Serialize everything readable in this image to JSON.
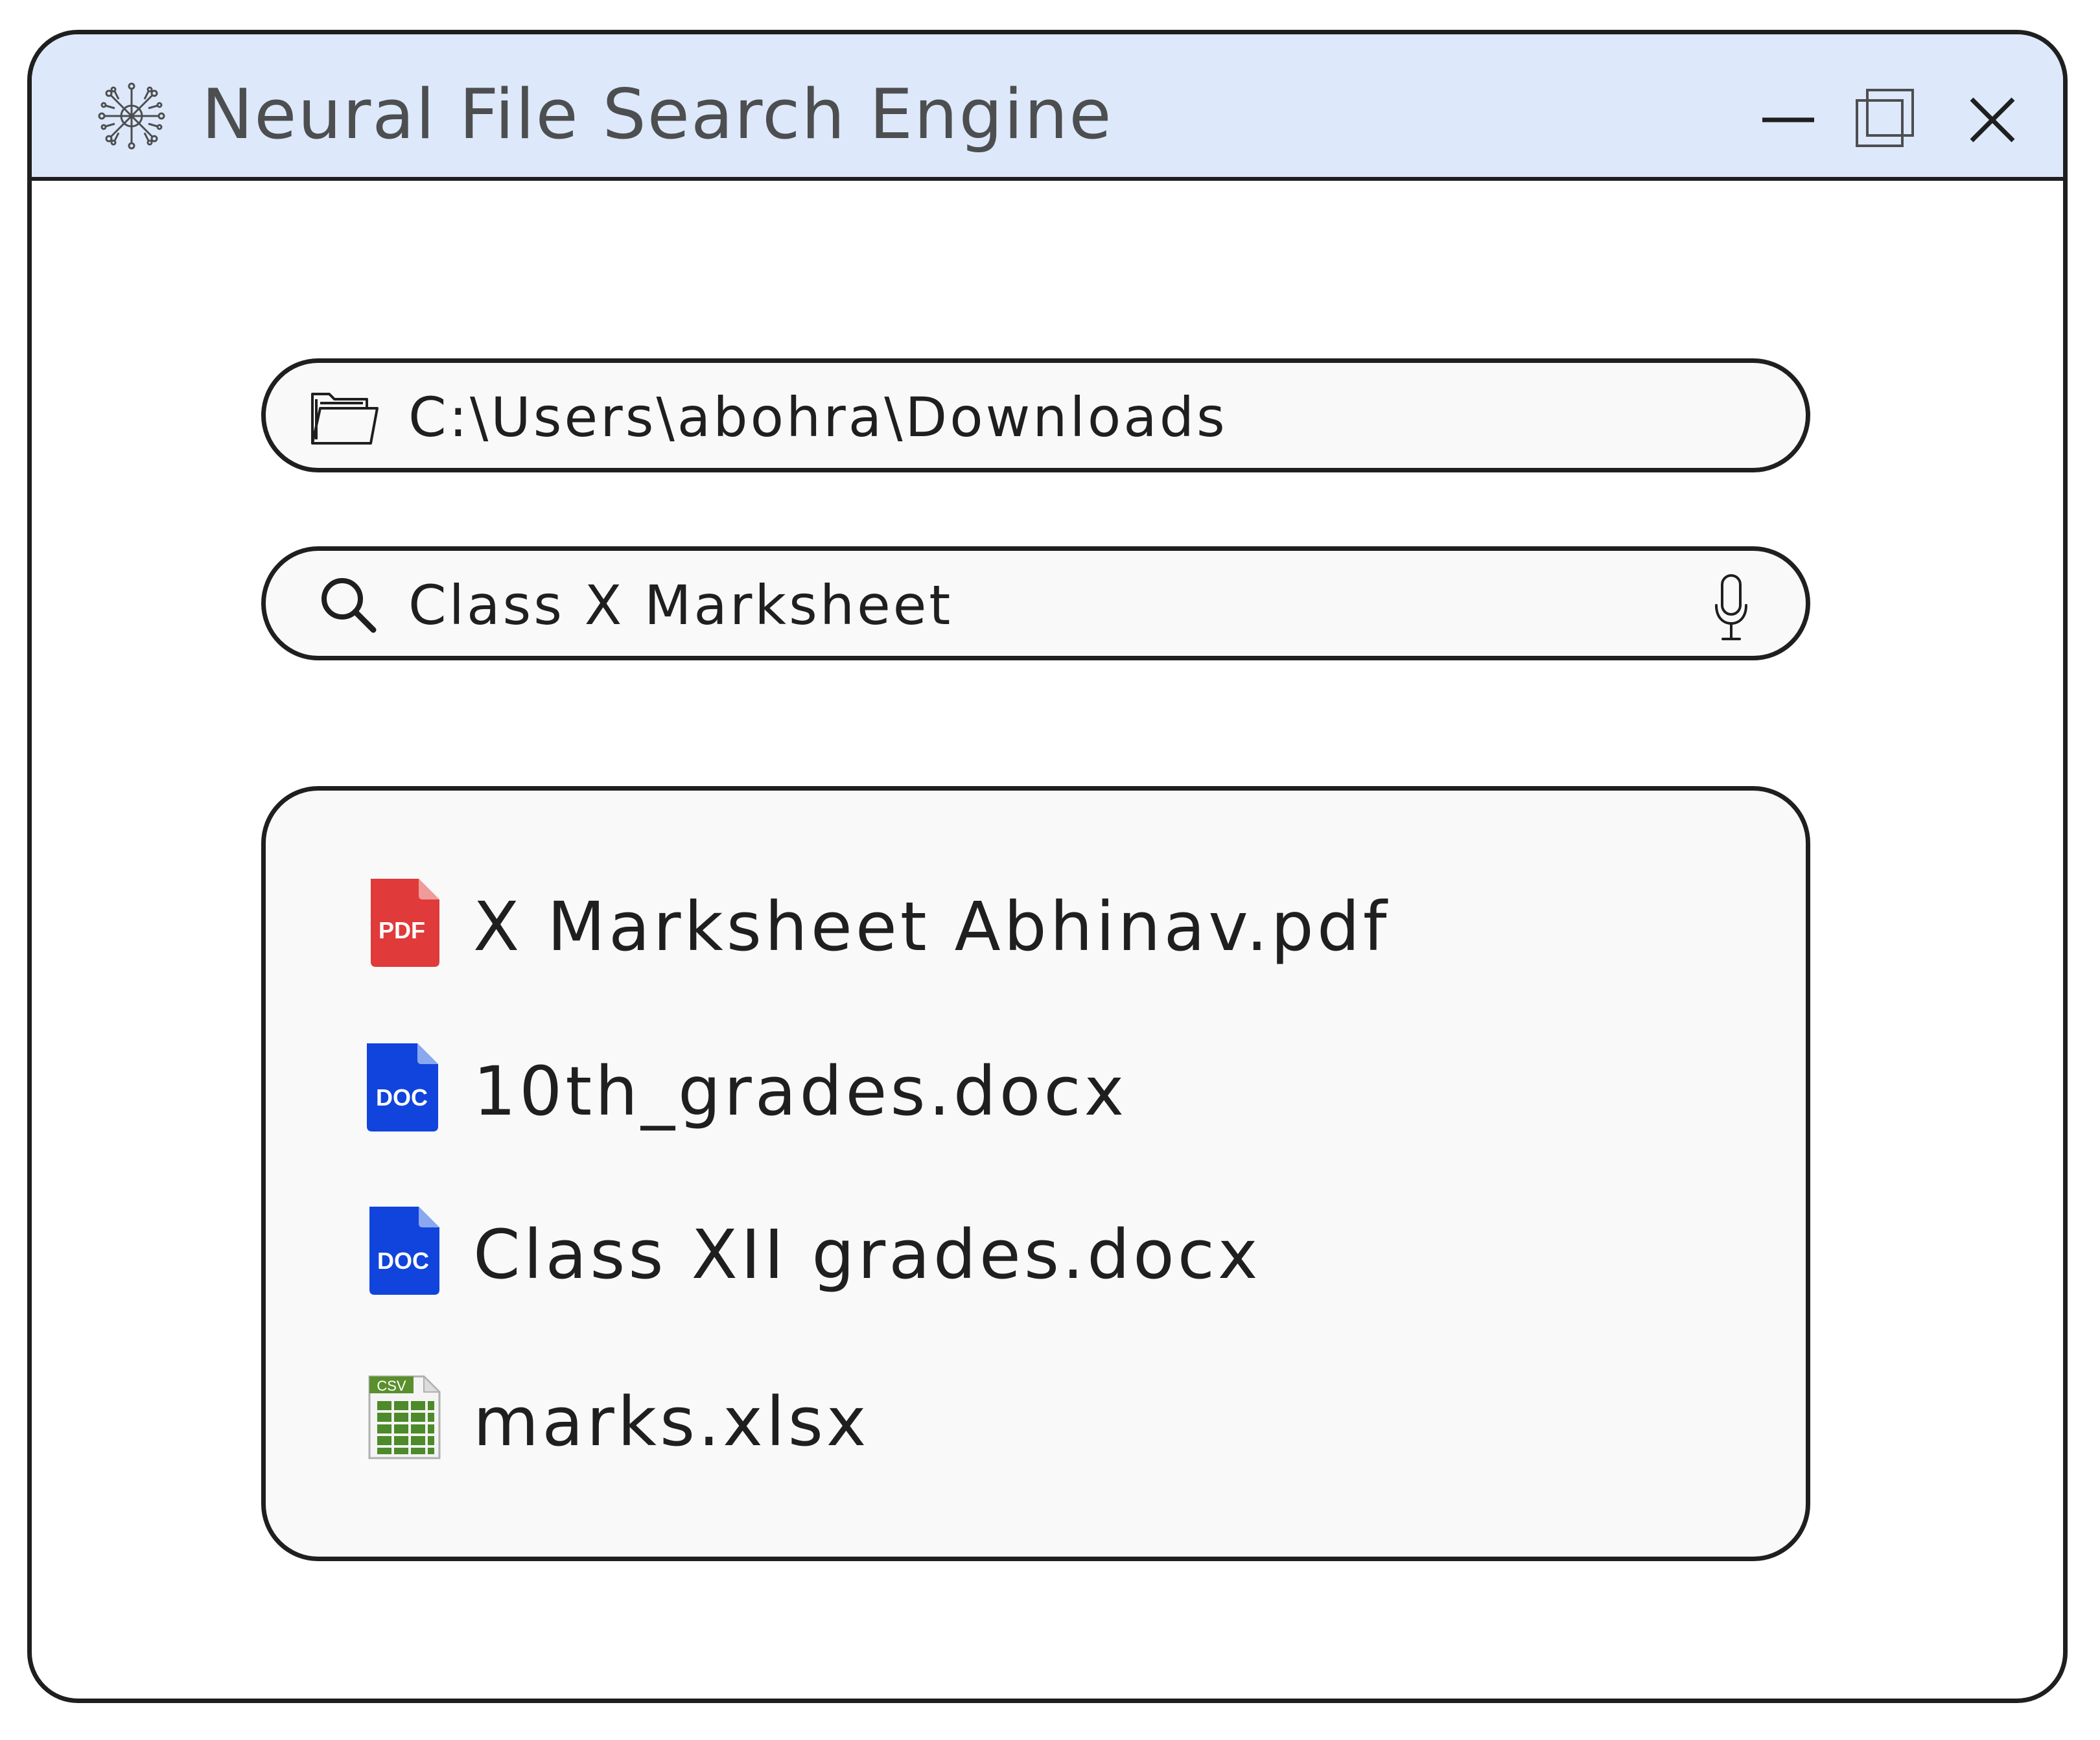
{
  "window": {
    "title": "Neural File Search Engine",
    "app_icon": "neural-brain-icon",
    "controls": {
      "minimize": "minimize-icon",
      "maximize": "maximize-icon",
      "close": "close-icon"
    }
  },
  "path_field": {
    "icon": "folder-icon",
    "value": "C:\\Users\\abohra\\Downloads"
  },
  "search": {
    "icon": "search-icon",
    "value": "Class X Marksheet",
    "voice_icon": "microphone-icon"
  },
  "results": [
    {
      "label": "X Marksheet Abhinav.pdf",
      "type": "pdf",
      "badge": "PDF",
      "color": "#e03a3a"
    },
    {
      "label": "10th_grades.docx",
      "type": "doc",
      "badge": "DOC",
      "color": "#1144dd"
    },
    {
      "label": "Class XII grades.docx",
      "type": "doc",
      "badge": "DOC",
      "color": "#1144dd"
    },
    {
      "label": "marks.xlsx",
      "type": "spreadsheet",
      "badge": "CSV",
      "color": "#5b8f2e"
    }
  ],
  "colors": {
    "titlebar_bg": "#dde9fa",
    "border": "#1f1f1f",
    "title_text": "#4d4e50",
    "field_bg": "#f9f9f9"
  }
}
